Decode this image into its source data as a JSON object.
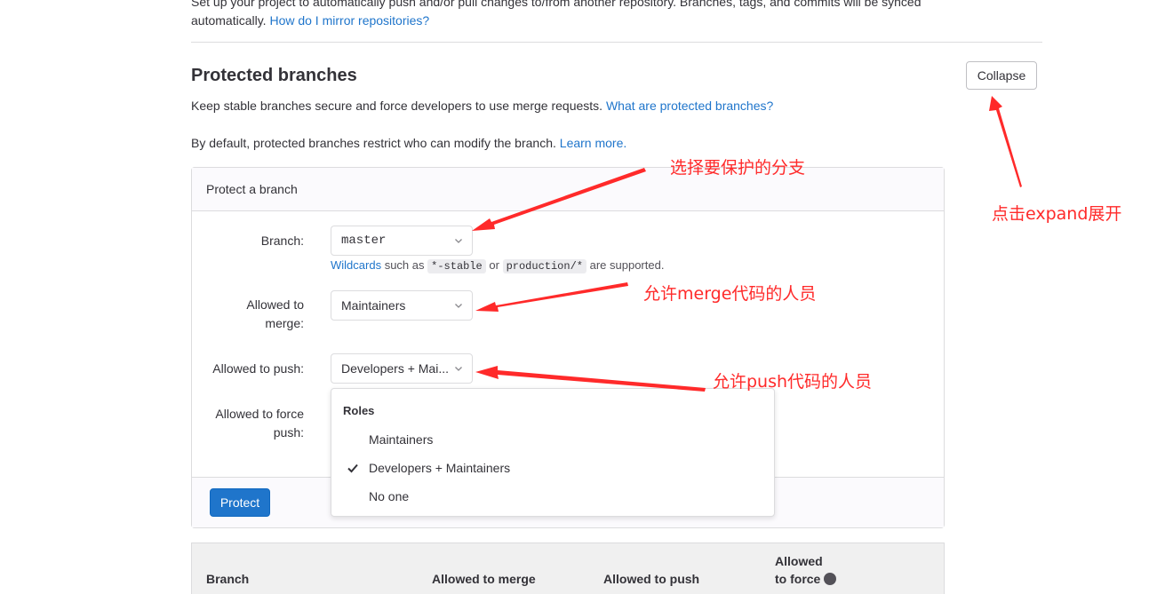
{
  "mirror": {
    "text": "Set up your project to automatically push and/or pull changes to/from another repository. Branches, tags, and commits will be synced automatically.",
    "link": "How do I mirror repositories?"
  },
  "protected_branches": {
    "title": "Protected branches",
    "collapse_label": "Collapse",
    "description": "Keep stable branches secure and force developers to use merge requests.",
    "description_link": "What are protected branches?",
    "default_text": "By default, protected branches restrict who can modify the branch.",
    "learn_more": "Learn more."
  },
  "form": {
    "header": "Protect a branch",
    "branch_label": "Branch:",
    "branch_value": "master",
    "wildcards_link": "Wildcards",
    "help_such_as": "such as",
    "help_code1": "*-stable",
    "help_or": "or",
    "help_code2": "production/*",
    "help_supported": "are supported.",
    "merge_label_line1": "Allowed to",
    "merge_label_line2": "merge:",
    "merge_value": "Maintainers",
    "push_label": "Allowed to push:",
    "push_value": "Developers + Mai...",
    "force_label_line1": "Allowed to force",
    "force_label_line2": "push:",
    "protect_button": "Protect"
  },
  "dropdown": {
    "header": "Roles",
    "items": [
      {
        "label": "Maintainers",
        "checked": false
      },
      {
        "label": "Developers + Maintainers",
        "checked": true
      },
      {
        "label": "No one",
        "checked": false
      }
    ]
  },
  "table": {
    "col_branch": "Branch",
    "col_merge": "Allowed to merge",
    "col_push": "Allowed to push",
    "col_force_line1": "Allowed",
    "col_force_line2": "to force"
  },
  "annotations": {
    "collapse_note": "点击expand展开",
    "branch_note": "选择要保护的分支",
    "merge_note": "允许merge代码的人员",
    "push_note": "允许push代码的人员",
    "color": "#ff2a2a"
  },
  "colors": {
    "accent": "#1f75cb",
    "text": "#333238",
    "border": "#dcdcde"
  }
}
